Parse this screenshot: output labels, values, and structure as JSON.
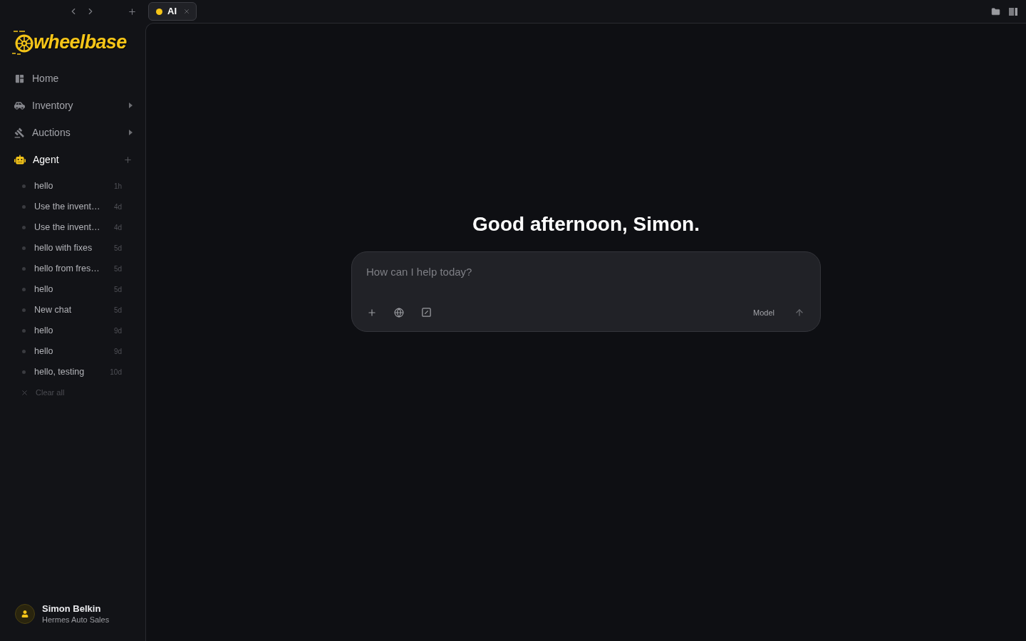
{
  "top_bar": {
    "tabs": [
      {
        "label": "AI",
        "selected": true
      }
    ]
  },
  "brand": {
    "logo_text": "wheelbase"
  },
  "nav": [
    {
      "label": "Home",
      "selected": false,
      "kind": "link"
    },
    {
      "label": "Inventory",
      "selected": false,
      "kind": "expandable"
    },
    {
      "label": "Auctions",
      "selected": false,
      "kind": "expandable"
    },
    {
      "label": "Agent",
      "selected": true,
      "kind": "addable"
    }
  ],
  "chats": [
    {
      "title": "hello",
      "age": "1h"
    },
    {
      "title": "Use the invent…",
      "age": "4d"
    },
    {
      "title": "Use the invent…",
      "age": "4d"
    },
    {
      "title": "hello with fixes",
      "age": "5d"
    },
    {
      "title": "hello from fres…",
      "age": "5d"
    },
    {
      "title": "hello",
      "age": "5d"
    },
    {
      "title": "New chat",
      "age": "5d"
    },
    {
      "title": "hello",
      "age": "9d"
    },
    {
      "title": "hello",
      "age": "9d"
    },
    {
      "title": "hello, testing",
      "age": "10d"
    }
  ],
  "clear_all": "Clear all",
  "user": {
    "name": "Simon Belkin",
    "company": "Hermes Auto Sales"
  },
  "greeting": "Good afternoon, Simon.",
  "composer": {
    "placeholder": "How can I help today?",
    "model_label": "Model"
  }
}
